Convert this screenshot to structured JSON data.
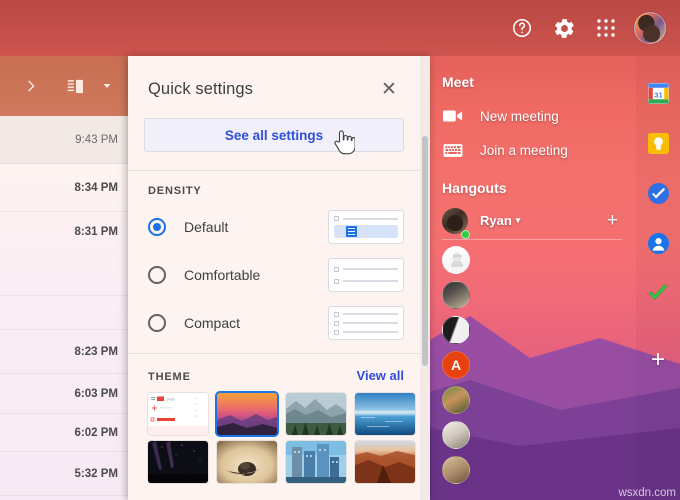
{
  "theme_colors": {
    "accent_blue": "#1a73e8",
    "link_blue": "#2f4fd8",
    "panel_bg": "#fdf4f1",
    "bg_top": "#c9544f",
    "bg_mid": "#f4706c",
    "bg_bottom": "#d75e82",
    "mountain_purple": "#7a3f96",
    "online_green": "#2ecc40"
  },
  "header": {
    "icons": [
      {
        "name": "help-icon",
        "label": "Support"
      },
      {
        "name": "gear-icon",
        "label": "Settings"
      },
      {
        "name": "apps-grid-icon",
        "label": "Google apps"
      },
      {
        "name": "avatar",
        "label": "Google Account"
      }
    ]
  },
  "left_toolbar": {
    "expand_label": ">",
    "buttons": [
      {
        "name": "expand-chevron-icon",
        "label": "Expand"
      },
      {
        "name": "split-pane-icon",
        "label": "Toggle split pane mode"
      },
      {
        "name": "chevron-down-icon",
        "label": "More"
      }
    ]
  },
  "mail_list": {
    "rows": [
      {
        "time": "9:43 PM",
        "read": true
      },
      {
        "time": "8:34 PM",
        "read": false
      },
      {
        "time": "8:31 PM",
        "read": false
      },
      {
        "time": "8:23 PM",
        "read": false
      },
      {
        "time": "6:03 PM",
        "read": false
      },
      {
        "time": "6:02 PM",
        "read": false
      },
      {
        "time": "5:32 PM",
        "read": false
      }
    ]
  },
  "quick_settings": {
    "title": "Quick settings",
    "close_label": "✕",
    "see_all_label": "See all settings",
    "density": {
      "section_label": "DENSITY",
      "options": [
        {
          "label": "Default",
          "selected": true,
          "preview_rows": 1
        },
        {
          "label": "Comfortable",
          "selected": false,
          "preview_rows": 2
        },
        {
          "label": "Compact",
          "selected": false,
          "preview_rows": 3
        }
      ]
    },
    "theme": {
      "section_label": "THEME",
      "view_all_label": "View all",
      "thumbnails": [
        {
          "name": "theme-gmail-default",
          "selected": false,
          "kind": "gmail"
        },
        {
          "name": "theme-sunset",
          "selected": true,
          "kind": "sunset"
        },
        {
          "name": "theme-mountains",
          "selected": false,
          "kind": "mountains"
        },
        {
          "name": "theme-blue-lake",
          "selected": false,
          "kind": "lake"
        },
        {
          "name": "theme-night-sky",
          "selected": false,
          "kind": "night"
        },
        {
          "name": "theme-desert-rock",
          "selected": false,
          "kind": "sand"
        },
        {
          "name": "theme-city-towers",
          "selected": false,
          "kind": "city"
        },
        {
          "name": "theme-canyon",
          "selected": false,
          "kind": "canyon"
        }
      ]
    }
  },
  "meet_panel": {
    "meet_heading": "Meet",
    "items": [
      {
        "name": "new-meeting",
        "label": "New meeting",
        "icon": "video-camera-icon"
      },
      {
        "name": "join-meeting",
        "label": "Join a meeting",
        "icon": "keyboard-icon"
      }
    ],
    "hangouts_heading": "Hangouts",
    "current_user": {
      "name": "Ryan",
      "status": "online",
      "caret": "▾"
    },
    "add_label": "+",
    "contacts": [
      {
        "name": "contact-1",
        "initial": "",
        "kind": "sketch"
      },
      {
        "name": "contact-2",
        "initial": "",
        "kind": "dark-photo"
      },
      {
        "name": "contact-3",
        "initial": "",
        "kind": "bw-photo"
      },
      {
        "name": "contact-4",
        "initial": "A",
        "kind": "initial"
      },
      {
        "name": "contact-5",
        "initial": "",
        "kind": "portrait-a"
      },
      {
        "name": "contact-6",
        "initial": "",
        "kind": "portrait-b"
      },
      {
        "name": "contact-7",
        "initial": "",
        "kind": "portrait-c"
      }
    ]
  },
  "side_rail": {
    "apps": [
      {
        "name": "google-calendar-icon",
        "label": "Calendar",
        "badge": "31"
      },
      {
        "name": "google-keep-icon",
        "label": "Keep",
        "badge": ""
      },
      {
        "name": "google-tasks-icon",
        "label": "Tasks",
        "badge": ""
      },
      {
        "name": "google-contacts-icon",
        "label": "Contacts",
        "badge": ""
      },
      {
        "name": "checkmark-icon",
        "label": "Done",
        "badge": ""
      }
    ],
    "add_label": "+"
  },
  "watermark": "wsxdn.com"
}
